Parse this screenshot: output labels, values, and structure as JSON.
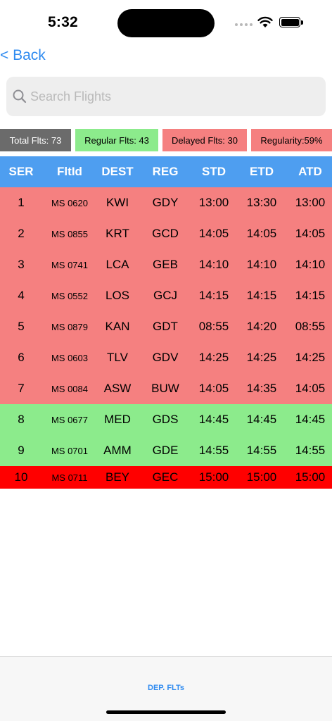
{
  "status_bar": {
    "time": "5:32"
  },
  "nav": {
    "back_label": "< Back"
  },
  "search": {
    "placeholder": "Search Flights",
    "value": ""
  },
  "stats": {
    "total": "Total Flts: 73",
    "regular": "Regular Flts: 43",
    "delayed": "Delayed Flts: 30",
    "regularity": "Regularity:59%"
  },
  "table": {
    "headers": [
      "SER",
      "FltId",
      "DEST",
      "REG",
      "STD",
      "ETD",
      "ATD"
    ],
    "rows": [
      {
        "ser": "1",
        "flt": "MS 0620",
        "dest": "KWI",
        "reg": "GDY",
        "std": "13:00",
        "etd": "13:30",
        "atd": "13:00",
        "status": "late"
      },
      {
        "ser": "2",
        "flt": "MS 0855",
        "dest": "KRT",
        "reg": "GCD",
        "std": "14:05",
        "etd": "14:05",
        "atd": "14:05",
        "status": "late"
      },
      {
        "ser": "3",
        "flt": "MS 0741",
        "dest": "LCA",
        "reg": "GEB",
        "std": "14:10",
        "etd": "14:10",
        "atd": "14:10",
        "status": "late"
      },
      {
        "ser": "4",
        "flt": "MS 0552",
        "dest": "LOS",
        "reg": "GCJ",
        "std": "14:15",
        "etd": "14:15",
        "atd": "14:15",
        "status": "late"
      },
      {
        "ser": "5",
        "flt": "MS 0879",
        "dest": "KAN",
        "reg": "GDT",
        "std": "08:55",
        "etd": "14:20",
        "atd": "08:55",
        "status": "late"
      },
      {
        "ser": "6",
        "flt": "MS 0603",
        "dest": "TLV",
        "reg": "GDV",
        "std": "14:25",
        "etd": "14:25",
        "atd": "14:25",
        "status": "late"
      },
      {
        "ser": "7",
        "flt": "MS 0084",
        "dest": "ASW",
        "reg": "BUW",
        "std": "14:05",
        "etd": "14:35",
        "atd": "14:05",
        "status": "late"
      },
      {
        "ser": "8",
        "flt": "MS 0677",
        "dest": "MED",
        "reg": "GDS",
        "std": "14:45",
        "etd": "14:45",
        "atd": "14:45",
        "status": "ontime"
      },
      {
        "ser": "9",
        "flt": "MS 0701",
        "dest": "AMM",
        "reg": "GDE",
        "std": "14:55",
        "etd": "14:55",
        "atd": "14:55",
        "status": "ontime"
      },
      {
        "ser": "10",
        "flt": "MS 0711",
        "dest": "BEY",
        "reg": "GEC",
        "std": "15:00",
        "etd": "15:00",
        "atd": "15:00",
        "status": "severe"
      }
    ]
  },
  "tab_bar": {
    "item_label": "DEP. FLTs"
  },
  "colors": {
    "accent": "#2f8bf0",
    "header_bg": "#4e9ef0",
    "late_bg": "#f58080",
    "ontime_bg": "#8ceb8c",
    "severe_bg": "#ff0000",
    "total_bg": "#6b6b6b"
  },
  "icons": {
    "search": "search-icon",
    "wifi": "wifi-icon",
    "battery": "battery-icon",
    "signal": "signal-icon"
  }
}
